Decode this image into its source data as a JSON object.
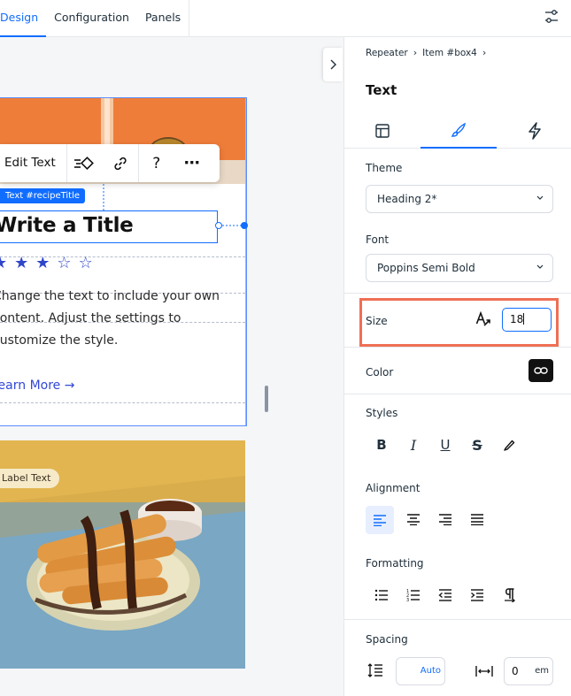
{
  "topbar": {
    "tabs": [
      {
        "label": "Design",
        "active": true
      },
      {
        "label": "Configuration",
        "active": false
      },
      {
        "label": "Panels",
        "active": false
      }
    ],
    "right_icon": "settings-sliders-icon"
  },
  "canvas": {
    "toolbar": {
      "edit_label": "Edit Text",
      "icons": [
        "animation-icon",
        "link-icon",
        "help-icon",
        "more-icon"
      ],
      "help_glyph": "?",
      "more_glyph": "⋯"
    },
    "element_tag": "Text #recipeTitle",
    "card": {
      "title": "Write a Title",
      "rating_filled": 3,
      "rating_total": 5,
      "description": "Change the text to include your own content. Adjust the settings to customize the style.",
      "link_label": "Learn More →"
    },
    "second_card": {
      "label": "Label Text"
    }
  },
  "panel": {
    "breadcrumb": [
      "Repeater",
      "Item #box4"
    ],
    "title": "Text",
    "tabs": [
      "layout-icon",
      "design-brush-icon",
      "interactions-bolt-icon"
    ],
    "theme": {
      "label": "Theme",
      "value": "Heading 2*"
    },
    "font": {
      "label": "Font",
      "value": "Poppins Semi Bold"
    },
    "size": {
      "label": "Size",
      "value": "18"
    },
    "color": {
      "label": "Color"
    },
    "styles": {
      "label": "Styles",
      "buttons": [
        "bold-icon",
        "italic-icon",
        "underline-icon",
        "strikethrough-icon",
        "highlight-icon"
      ]
    },
    "alignment": {
      "label": "Alignment",
      "buttons": [
        "align-left-icon",
        "align-center-icon",
        "align-right-icon",
        "align-justify-icon"
      ],
      "active": 0
    },
    "formatting": {
      "label": "Formatting",
      "buttons": [
        "bullet-list-icon",
        "numbered-list-icon",
        "outdent-icon",
        "indent-icon",
        "text-direction-icon"
      ]
    },
    "spacing": {
      "label": "Spacing",
      "line_height": "Auto",
      "letter_value": "0",
      "letter_unit": "em"
    }
  },
  "colors": {
    "accent": "#116dff",
    "highlight_frame": "#ef6f55",
    "link": "#3348d6",
    "star": "#2f46c9"
  }
}
